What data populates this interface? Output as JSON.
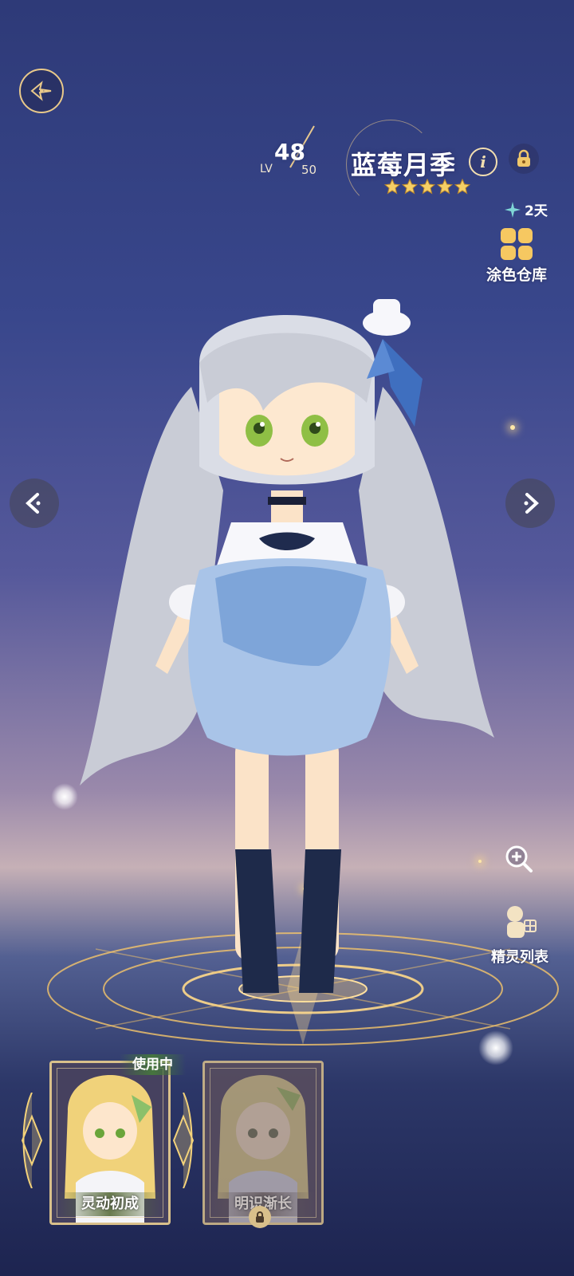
{
  "header": {
    "level": {
      "label": "LV",
      "current": "48",
      "max": "50"
    },
    "spirit_name": "蓝莓月季",
    "info_icon": "info-icon",
    "lock_icon": "lock-icon",
    "star_rating": 5
  },
  "side_panel": {
    "timer_label": "2天",
    "paint_library_label": "涂色仓库",
    "zoom_icon": "zoom-in-icon",
    "spirit_list_label": "精灵列表"
  },
  "skins": [
    {
      "name": "灵动初成",
      "status": "使用中",
      "locked": false
    },
    {
      "name": "明识渐长",
      "status": "",
      "locked": true
    }
  ],
  "colors": {
    "gold": "#d9c08b",
    "accent_teal": "#7fd6d6",
    "paint_yellow": "#f6c861"
  }
}
